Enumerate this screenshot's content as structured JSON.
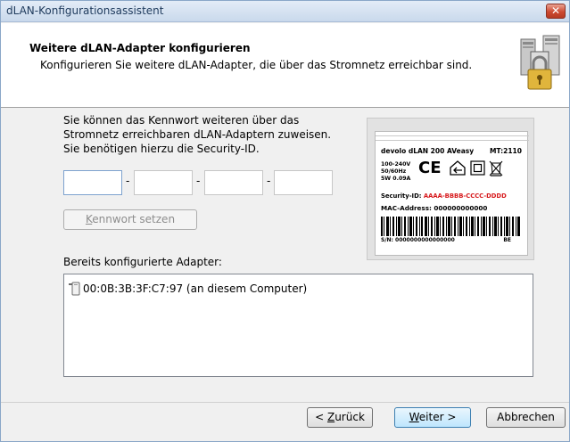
{
  "window": {
    "title": "dLAN-Konfigurationsassistent",
    "close_glyph": "✕"
  },
  "header": {
    "title": "Weitere dLAN-Adapter konfigurieren",
    "subtitle": "Konfigurieren Sie weitere dLAN-Adapter, die über das Stromnetz erreichbar sind.",
    "icon": "computers-padlock-icon"
  },
  "intro": {
    "line1": "Sie können das Kennwort weiteren über das",
    "line2": "Stromnetz erreichbaren dLAN-Adaptern zuweisen.",
    "line3": "Sie benötigen hierzu die Security-ID."
  },
  "security_id": {
    "fields": [
      "",
      "",
      "",
      ""
    ],
    "separator": "-"
  },
  "set_password_button": {
    "accel": "K",
    "rest": "ennwort setzen",
    "disabled": true
  },
  "configured": {
    "label": "Bereits konfigurierte Adapter:",
    "items": [
      {
        "text": "00:0B:3B:3F:C7:97  (an diesem Computer)",
        "icon": "dlan-adapter-icon"
      }
    ]
  },
  "adapter_label": {
    "product": "devolo dLAN 200 AVeasy",
    "model": "MT:2110",
    "spec_line1": "100-240V",
    "spec_line2": "50/60Hz",
    "spec_line3": "5W 0.09A",
    "ce": "CE",
    "security_prefix": "Security-ID: ",
    "security_value": "AAAA-BBBB-CCCC-DDDD",
    "mac": "MAC-Address: 000000000000",
    "sn": "S/N: 0000000000000000",
    "country": "BE"
  },
  "footer": {
    "back": {
      "accel": "Z",
      "prefix": "< ",
      "rest": "urück"
    },
    "next": {
      "accel": "W",
      "rest": "eiter >"
    },
    "cancel": "Abbrechen"
  },
  "colors": {
    "title_bar": "#c9d9ec",
    "security_id_red": "#d7191c",
    "default_button": "#bee6fd"
  }
}
